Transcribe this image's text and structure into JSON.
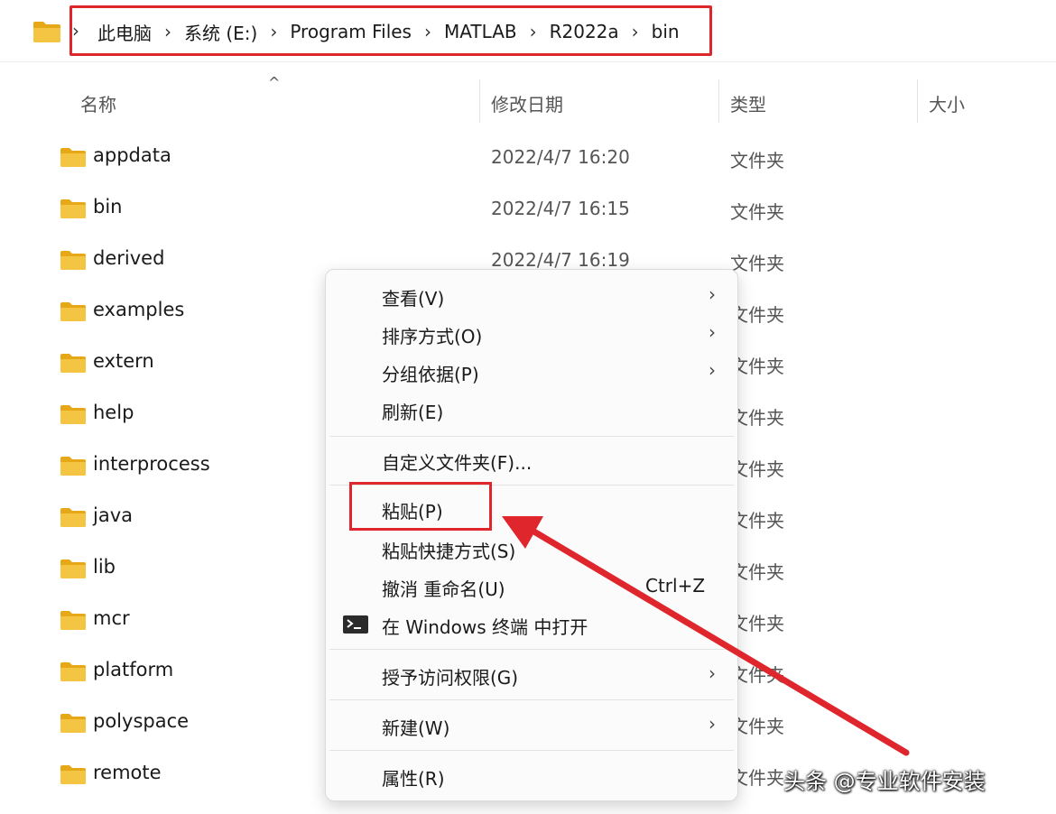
{
  "address_bar": {
    "breadcrumbs": [
      "此电脑",
      "系统 (E:)",
      "Program Files",
      "MATLAB",
      "R2022a",
      "bin"
    ],
    "separator": "›"
  },
  "columns": {
    "name": "名称",
    "modified": "修改日期",
    "type": "类型",
    "size": "大小"
  },
  "files": [
    {
      "name": "appdata",
      "date": "2022/4/7 16:20",
      "type": "文件夹"
    },
    {
      "name": "bin",
      "date": "2022/4/7 16:15",
      "type": "文件夹"
    },
    {
      "name": "derived",
      "date": "2022/4/7 16:19",
      "type": "文件夹"
    },
    {
      "name": "examples",
      "date": "",
      "type": "文件夹"
    },
    {
      "name": "extern",
      "date": "",
      "type": "文件夹"
    },
    {
      "name": "help",
      "date": "",
      "type": "文件夹"
    },
    {
      "name": "interprocess",
      "date": "",
      "type": "文件夹"
    },
    {
      "name": "java",
      "date": "",
      "type": "文件夹"
    },
    {
      "name": "lib",
      "date": "",
      "type": "文件夹"
    },
    {
      "name": "mcr",
      "date": "",
      "type": "文件夹"
    },
    {
      "name": "platform",
      "date": "",
      "type": "文件夹"
    },
    {
      "name": "polyspace",
      "date": "",
      "type": "文件夹"
    },
    {
      "name": "remote",
      "date": "",
      "type": "文件夹"
    }
  ],
  "context_menu": {
    "view": "查看(V)",
    "sort_by": "排序方式(O)",
    "group_by": "分组依据(P)",
    "refresh": "刷新(E)",
    "customize": "自定义文件夹(F)...",
    "paste": "粘贴(P)",
    "paste_shortcut": "粘贴快捷方式(S)",
    "undo_rename": "撤消 重命名(U)",
    "undo_shortcut": "Ctrl+Z",
    "open_terminal": "在 Windows 终端 中打开",
    "grant_access": "授予访问权限(G)",
    "new": "新建(W)",
    "properties": "属性(R)",
    "chevron": "›",
    "terminal_icon": "terminal-icon"
  },
  "watermark": "头条 @专业软件安装",
  "colors": {
    "highlight": "#e0262d",
    "folder": "#f4c542",
    "folder_dark": "#e6a817"
  }
}
